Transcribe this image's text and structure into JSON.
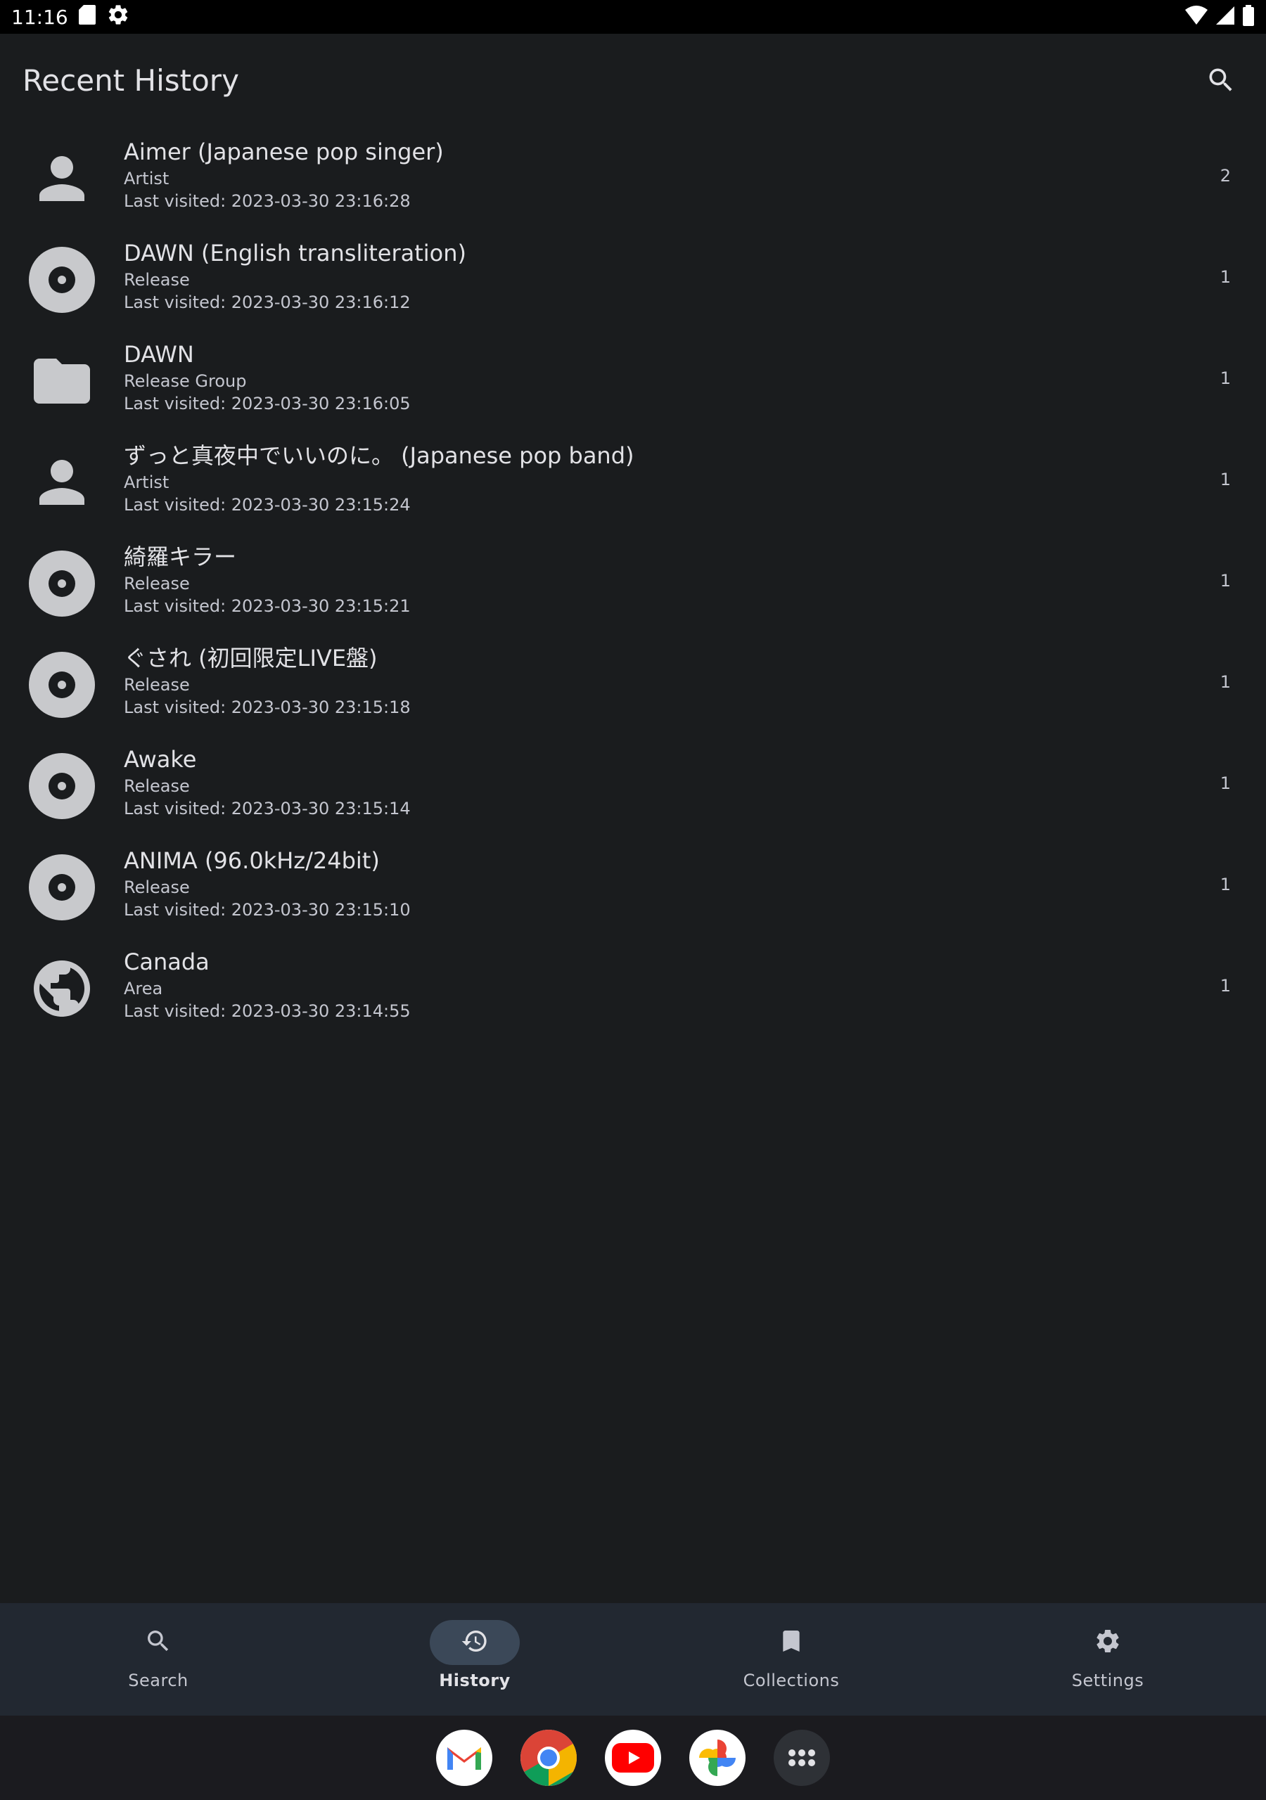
{
  "status_bar": {
    "time": "11:16",
    "left_icons": [
      "sd-card-icon",
      "settings-gear-icon"
    ],
    "right_icons": [
      "wifi-icon",
      "signal-icon",
      "battery-icon"
    ]
  },
  "header": {
    "title": "Recent History",
    "search_icon": "search-icon"
  },
  "history": [
    {
      "name": "Aimer (Japanese pop singer)",
      "type": "Artist",
      "visited": "Last visited: 2023-03-30 23:16:28",
      "count": "2",
      "icon": "person-icon"
    },
    {
      "name": "DAWN (English transliteration)",
      "type": "Release",
      "visited": "Last visited: 2023-03-30 23:16:12",
      "count": "1",
      "icon": "disc-icon"
    },
    {
      "name": "DAWN",
      "type": "Release Group",
      "visited": "Last visited: 2023-03-30 23:16:05",
      "count": "1",
      "icon": "folder-icon"
    },
    {
      "name": "ずっと真夜中でいいのに。 (Japanese pop band)",
      "type": "Artist",
      "visited": "Last visited: 2023-03-30 23:15:24",
      "count": "1",
      "icon": "person-icon"
    },
    {
      "name": "綺羅キラー",
      "type": "Release",
      "visited": "Last visited: 2023-03-30 23:15:21",
      "count": "1",
      "icon": "disc-icon"
    },
    {
      "name": "ぐされ (初回限定LIVE盤)",
      "type": "Release",
      "visited": "Last visited: 2023-03-30 23:15:18",
      "count": "1",
      "icon": "disc-icon"
    },
    {
      "name": "Awake",
      "type": "Release",
      "visited": "Last visited: 2023-03-30 23:15:14",
      "count": "1",
      "icon": "disc-icon"
    },
    {
      "name": "ANIMA (96.0kHz/24bit)",
      "type": "Release",
      "visited": "Last visited: 2023-03-30 23:15:10",
      "count": "1",
      "icon": "disc-icon"
    },
    {
      "name": "Canada",
      "type": "Area",
      "visited": "Last visited: 2023-03-30 23:14:55",
      "count": "1",
      "icon": "globe-icon"
    }
  ],
  "nav": {
    "items": [
      {
        "label": "Search",
        "icon": "search-icon",
        "active": false
      },
      {
        "label": "History",
        "icon": "history-icon",
        "active": true
      },
      {
        "label": "Collections",
        "icon": "bookmark-icon",
        "active": false
      },
      {
        "label": "Settings",
        "icon": "gear-icon",
        "active": false
      }
    ]
  },
  "dock": {
    "apps": [
      "gmail-icon",
      "chrome-icon",
      "youtube-icon",
      "photos-icon",
      "app-drawer-icon"
    ]
  },
  "colors": {
    "background": "#1a1c1e",
    "nav_background": "#222831",
    "active_pill": "#3b4858",
    "icon_gray": "#c8c9cc",
    "text_primary": "#e2e2e6",
    "text_secondary": "#c4c6cf"
  }
}
